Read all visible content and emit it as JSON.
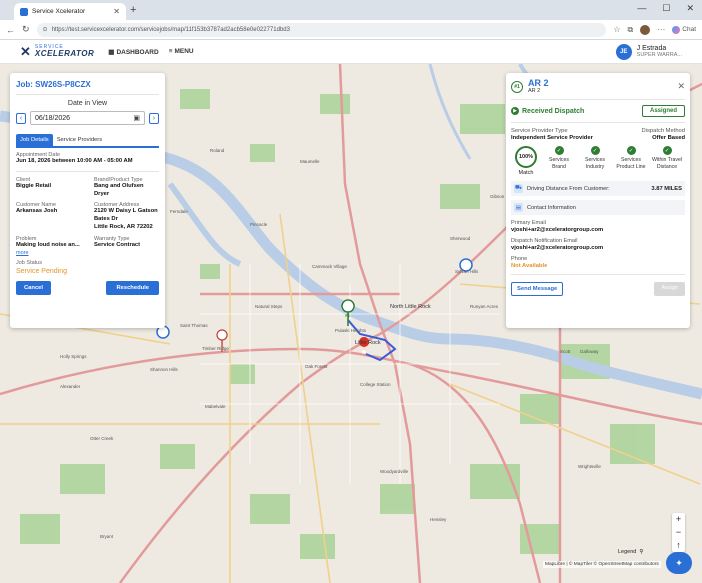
{
  "browser": {
    "tab_title": "Service Xcelerator",
    "url": "https://test.servicexcelerator.com/servicejobs/map/11f153b3787ad2acb58e0e022771dbd3",
    "copilot_label": "Chat"
  },
  "header": {
    "logo_top": "SERVICE",
    "logo_bottom": "XCELERATOR",
    "nav": [
      {
        "label": "DASHBOARD",
        "icon": "grid-icon"
      },
      {
        "label": "MENU",
        "icon": "hamburger-icon"
      }
    ],
    "user": {
      "initials": "JE",
      "name": "J Estrada",
      "role": "SUPER WARRA..."
    }
  },
  "job": {
    "title": "Job: SW26S-P8CZX",
    "date_label": "Date in View",
    "date_value": "06/18/2026",
    "tabs": [
      "Job Details",
      "Service Providers"
    ],
    "appointment_label": "Appointment Date",
    "appointment_value": "Jun 18, 2026 between 10:00 AM - 05:00 AM",
    "client_label": "Client",
    "client_value": "Biggie Retail",
    "brand_label": "Brand/Product Type",
    "brand_value": "Bang and Olufsen Dryer",
    "customer_label": "Customer Name",
    "customer_value": "Arkansas Josh",
    "address_label": "Customer Address",
    "address_lines": [
      "2120 W Daisy L Gatson",
      "Bates Dr",
      "Little Rock, AR 72202"
    ],
    "problem_label": "Problem",
    "problem_value": "Making loud noise an...",
    "more_label": "more",
    "warranty_label": "Warranty Type",
    "warranty_value": "Service Contract",
    "status_label": "Job Status",
    "status_value": "Service Pending",
    "cancel_label": "Cancel",
    "reschedule_label": "Reschedule"
  },
  "dispatch": {
    "badge": "#1",
    "name": "AR 2",
    "sub": "AR 2",
    "received_label": "Received Dispatch",
    "assigned_label": "Assigned",
    "sp_type_label": "Service Provider Type",
    "sp_type_value": "Independent Service Provider",
    "method_label": "Dispatch Method",
    "method_value": "Offer Based",
    "match_value": "100%",
    "match_label": "Match",
    "criteria": [
      {
        "line1": "Services",
        "line2": "Brand"
      },
      {
        "line1": "Services",
        "line2": "Industry"
      },
      {
        "line1": "Services",
        "line2": "Product Line"
      },
      {
        "line1": "Within Travel",
        "line2": "Distance"
      }
    ],
    "distance_label": "Driving Distance From Customer:",
    "distance_value": "3.87 MILES",
    "contact_label": "Contact Information",
    "primary_email_label": "Primary Email",
    "primary_email_value": "vjoshi+ar2@xceleratorgroup.com",
    "notif_email_label": "Dispatch Notification Email",
    "notif_email_value": "vjoshi+ar2@xceleratorgroup.com",
    "phone_label": "Phone",
    "phone_value": "Not Available",
    "send_label": "Send Message",
    "assign_label": "Assign"
  },
  "map": {
    "labels": [
      "North Little Rock",
      "Little Rock",
      "Maumelle",
      "Sherwood",
      "Jacksonville",
      "Roland",
      "Cammack Village",
      "Saint Thomas",
      "Timber Ridge",
      "Oak Forest",
      "Hensley",
      "Wrightsville",
      "Woodyardville",
      "College Station",
      "Holly Springs",
      "Alexander",
      "Shannon Hills",
      "Mabelvale",
      "Otter Creek",
      "Scott",
      "Pulaski Heights",
      "Ferndale",
      "Pinnacle",
      "Natural Steps",
      "Sylvan Hills",
      "Gibson",
      "Cato",
      "Runyan Acres",
      "Galloway",
      "Bryant"
    ],
    "legend_label": "Legend",
    "attribution": "MapLibre | © MapTiler © OpenStreetMap contributors",
    "zoom_in": "+",
    "zoom_out": "−",
    "compass": "↑"
  },
  "colors": {
    "accent": "#2a6fd6",
    "success": "#2e7d32",
    "warning": "#e0952a",
    "water": "#b9cde6",
    "park": "#9cc98a"
  }
}
